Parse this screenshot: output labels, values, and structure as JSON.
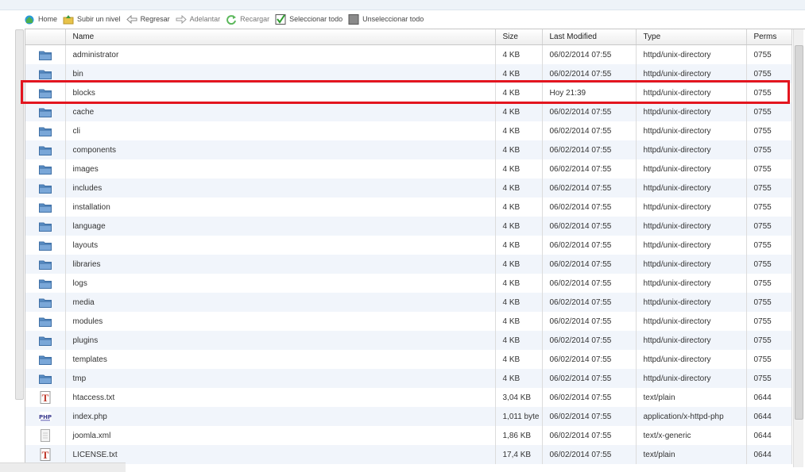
{
  "toolbar": {
    "home": "Home",
    "up": "Subir un nivel",
    "back": "Regresar",
    "forward": "Adelantar",
    "reload": "Recargar",
    "select_all": "Seleccionar todo",
    "unselect_all": "Unseleccionar todo"
  },
  "columns": {
    "name": "Name",
    "size": "Size",
    "modified": "Last Modified",
    "type": "Type",
    "perms": "Perms"
  },
  "colors": {
    "highlight_border": "#e3151f",
    "row_alt": "#f1f5fb",
    "folder": "#5b8fc7"
  },
  "rows": [
    {
      "icon": "folder-icon",
      "name": "administrator",
      "size": "4 KB",
      "modified": "06/02/2014 07:55",
      "type": "httpd/unix-directory",
      "perms": "0755"
    },
    {
      "icon": "folder-icon",
      "name": "bin",
      "size": "4 KB",
      "modified": "06/02/2014 07:55",
      "type": "httpd/unix-directory",
      "perms": "0755"
    },
    {
      "icon": "folder-icon",
      "name": "blocks",
      "size": "4 KB",
      "modified": "Hoy 21:39",
      "type": "httpd/unix-directory",
      "perms": "0755"
    },
    {
      "icon": "folder-icon",
      "name": "cache",
      "size": "4 KB",
      "modified": "06/02/2014 07:55",
      "type": "httpd/unix-directory",
      "perms": "0755"
    },
    {
      "icon": "folder-icon",
      "name": "cli",
      "size": "4 KB",
      "modified": "06/02/2014 07:55",
      "type": "httpd/unix-directory",
      "perms": "0755"
    },
    {
      "icon": "folder-icon",
      "name": "components",
      "size": "4 KB",
      "modified": "06/02/2014 07:55",
      "type": "httpd/unix-directory",
      "perms": "0755"
    },
    {
      "icon": "folder-icon",
      "name": "images",
      "size": "4 KB",
      "modified": "06/02/2014 07:55",
      "type": "httpd/unix-directory",
      "perms": "0755"
    },
    {
      "icon": "folder-icon",
      "name": "includes",
      "size": "4 KB",
      "modified": "06/02/2014 07:55",
      "type": "httpd/unix-directory",
      "perms": "0755"
    },
    {
      "icon": "folder-icon",
      "name": "installation",
      "size": "4 KB",
      "modified": "06/02/2014 07:55",
      "type": "httpd/unix-directory",
      "perms": "0755"
    },
    {
      "icon": "folder-icon",
      "name": "language",
      "size": "4 KB",
      "modified": "06/02/2014 07:55",
      "type": "httpd/unix-directory",
      "perms": "0755"
    },
    {
      "icon": "folder-icon",
      "name": "layouts",
      "size": "4 KB",
      "modified": "06/02/2014 07:55",
      "type": "httpd/unix-directory",
      "perms": "0755"
    },
    {
      "icon": "folder-icon",
      "name": "libraries",
      "size": "4 KB",
      "modified": "06/02/2014 07:55",
      "type": "httpd/unix-directory",
      "perms": "0755"
    },
    {
      "icon": "folder-icon",
      "name": "logs",
      "size": "4 KB",
      "modified": "06/02/2014 07:55",
      "type": "httpd/unix-directory",
      "perms": "0755"
    },
    {
      "icon": "folder-icon",
      "name": "media",
      "size": "4 KB",
      "modified": "06/02/2014 07:55",
      "type": "httpd/unix-directory",
      "perms": "0755"
    },
    {
      "icon": "folder-icon",
      "name": "modules",
      "size": "4 KB",
      "modified": "06/02/2014 07:55",
      "type": "httpd/unix-directory",
      "perms": "0755"
    },
    {
      "icon": "folder-icon",
      "name": "plugins",
      "size": "4 KB",
      "modified": "06/02/2014 07:55",
      "type": "httpd/unix-directory",
      "perms": "0755"
    },
    {
      "icon": "folder-icon",
      "name": "templates",
      "size": "4 KB",
      "modified": "06/02/2014 07:55",
      "type": "httpd/unix-directory",
      "perms": "0755"
    },
    {
      "icon": "folder-icon",
      "name": "tmp",
      "size": "4 KB",
      "modified": "06/02/2014 07:55",
      "type": "httpd/unix-directory",
      "perms": "0755"
    },
    {
      "icon": "text-file-icon",
      "name": "htaccess.txt",
      "size": "3,04 KB",
      "modified": "06/02/2014 07:55",
      "type": "text/plain",
      "perms": "0644"
    },
    {
      "icon": "php-file-icon",
      "name": "index.php",
      "size": "1,011 byte",
      "modified": "06/02/2014 07:55",
      "type": "application/x-httpd-php",
      "perms": "0644"
    },
    {
      "icon": "generic-file-icon",
      "name": "joomla.xml",
      "size": "1,86 KB",
      "modified": "06/02/2014 07:55",
      "type": "text/x-generic",
      "perms": "0644"
    },
    {
      "icon": "text-file-icon",
      "name": "LICENSE.txt",
      "size": "17,4 KB",
      "modified": "06/02/2014 07:55",
      "type": "text/plain",
      "perms": "0644"
    }
  ]
}
